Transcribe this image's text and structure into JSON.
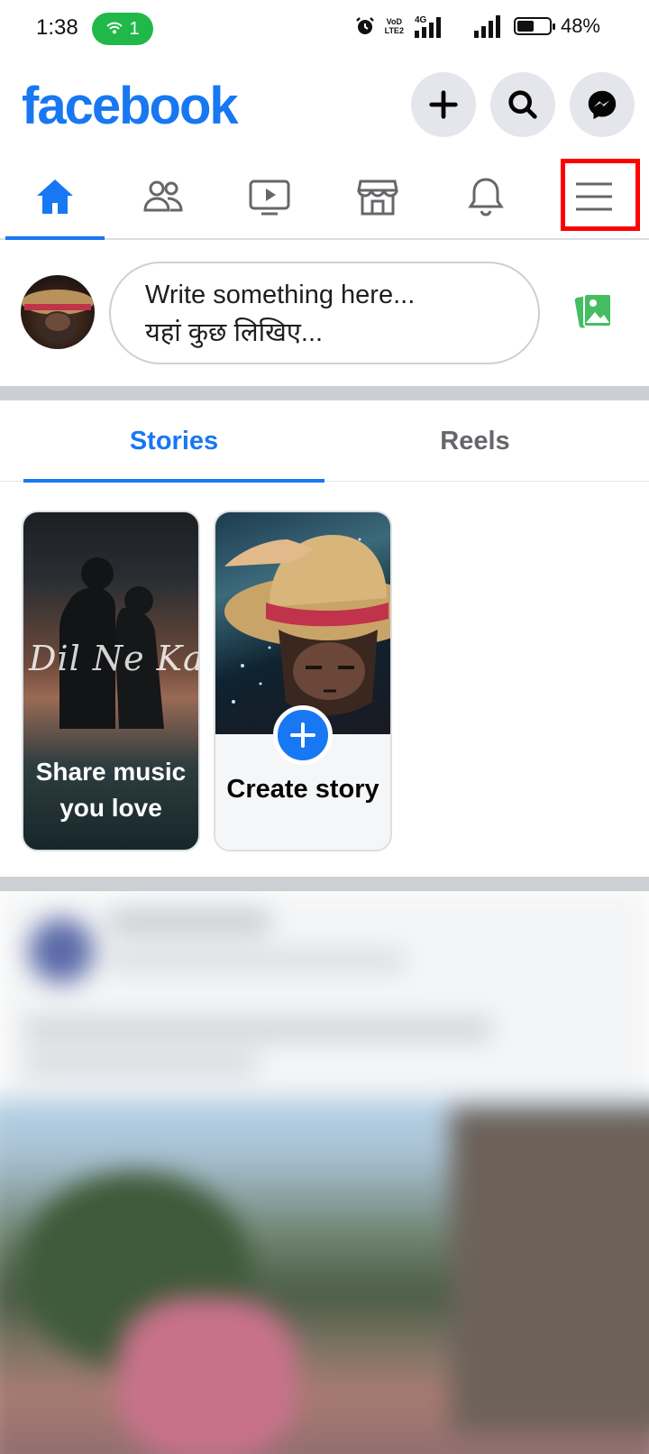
{
  "status_bar": {
    "time": "1:38",
    "hotspot_count": "1",
    "network_label": "4G",
    "volte_label": "VoD LTE2",
    "battery_percent": "48%",
    "battery_level": 0.48
  },
  "header": {
    "logo_text": "facebook",
    "brand_color": "#1877f2",
    "buttons": [
      "plus-icon",
      "search-icon",
      "messenger-icon"
    ]
  },
  "nav": {
    "tabs": [
      "home",
      "friends",
      "watch",
      "marketplace",
      "notifications",
      "menu"
    ],
    "active_tab": "home"
  },
  "composer": {
    "line1": "Write something here...",
    "line2": "यहां कुछ लिखिए..."
  },
  "stories_tabs": {
    "stories_label": "Stories",
    "reels_label": "Reels"
  },
  "stories": {
    "music_card": {
      "overlay_script": "Dil Ne Kah",
      "label": "Share music you love"
    },
    "create_card": {
      "label": "Create story"
    }
  }
}
